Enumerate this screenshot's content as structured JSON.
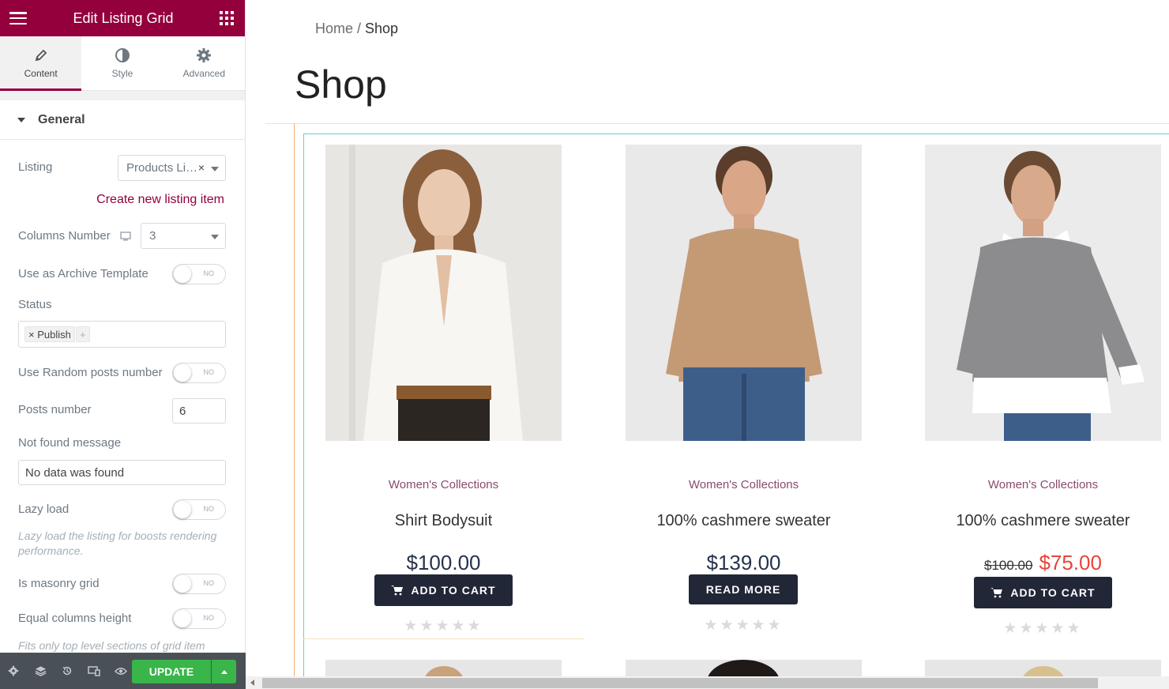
{
  "panel": {
    "title": "Edit Listing Grid",
    "tabs": [
      {
        "label": "Content",
        "icon": "pencil-icon"
      },
      {
        "label": "Style",
        "icon": "half-circle-icon"
      },
      {
        "label": "Advanced",
        "icon": "gear-icon"
      }
    ],
    "section": "General",
    "listing_label": "Listing",
    "listing_value": "Products Li…",
    "listing_clear": "×",
    "create_link": "Create new listing item",
    "columns_label": "Columns Number",
    "columns_value": "3",
    "archive_label": "Use as Archive Template",
    "status_label": "Status",
    "status_tag": "× Publish",
    "status_add": "+",
    "random_label": "Use Random posts number",
    "posts_label": "Posts number",
    "posts_value": "6",
    "notfound_label": "Not found message",
    "notfound_value": "No data was found",
    "lazy_label": "Lazy load",
    "lazy_note": "Lazy load the listing for boosts rendering performance.",
    "masonry_label": "Is masonry grid",
    "equal_label": "Equal columns height",
    "equal_note": "Fits only top level sections of grid item",
    "toggle_text": "NO",
    "update_label": "UPDATE"
  },
  "preview": {
    "breadcrumb_home": "Home",
    "breadcrumb_sep": " / ",
    "breadcrumb_current": "Shop",
    "page_title": "Shop",
    "products": [
      {
        "category": "Women's Collections",
        "name": "Shirt Bodysuit",
        "price": "$100.00",
        "old_price": "",
        "button": "ADD TO CART",
        "rating": "★★★★★"
      },
      {
        "category": "Women's Collections",
        "name": "100% cashmere sweater",
        "price": "$139.00",
        "old_price": "",
        "button": "READ MORE",
        "rating": "★★★★★"
      },
      {
        "category": "Women's Collections",
        "name": "100% cashmere sweater",
        "price": "$75.00",
        "old_price": "$100.00",
        "button": "ADD TO CART",
        "rating": "★★★★★"
      }
    ]
  },
  "colors": {
    "brand": "#93003c",
    "update": "#39b54a",
    "button_dark": "#222737",
    "sale": "#e8453c",
    "category": "#8a4a6e"
  }
}
